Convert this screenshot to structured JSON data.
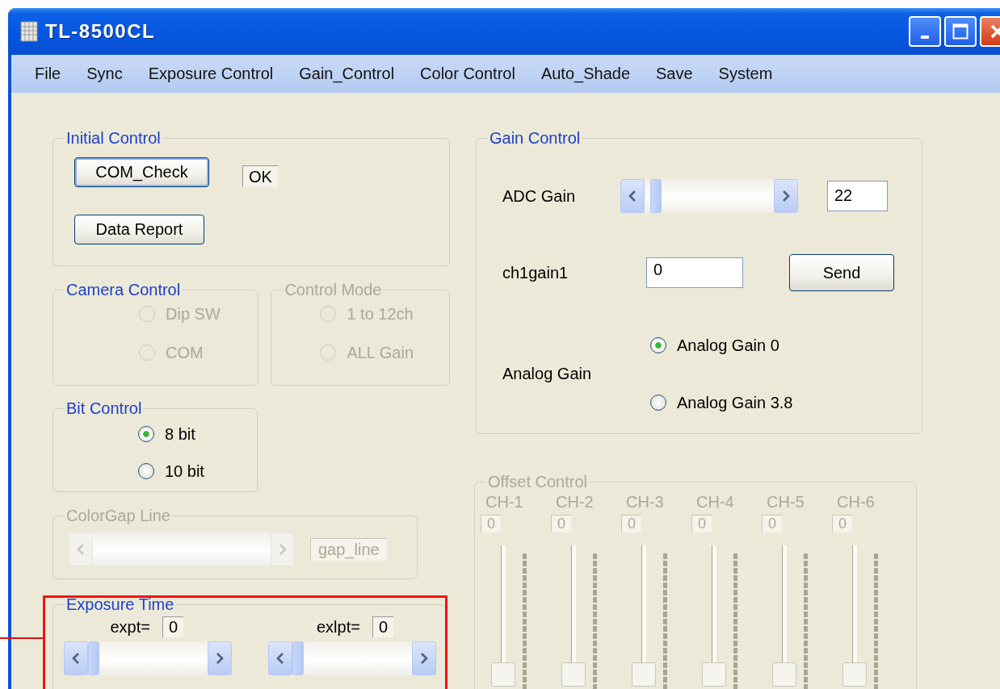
{
  "window": {
    "title": "TL-8500CL"
  },
  "menu": [
    "File",
    "Sync",
    "Exposure Control",
    "Gain_Control",
    "Color Control",
    "Auto_Shade",
    "Save",
    "System"
  ],
  "initial_control": {
    "title": "Initial Control",
    "disabled": false,
    "buttons": [
      {
        "label": "COM_Check",
        "focused": true
      },
      {
        "label": "Data Report",
        "focused": false
      }
    ],
    "status": "OK"
  },
  "camera_control": {
    "title": "Camera Control",
    "disabled": false,
    "options": [
      {
        "label": "Dip SW",
        "selected": false,
        "disabled": true
      },
      {
        "label": "COM",
        "selected": false,
        "disabled": true
      }
    ]
  },
  "control_mode": {
    "title": "Control Mode",
    "disabled": true,
    "options": [
      {
        "label": "1 to 12ch",
        "selected": false,
        "disabled": true
      },
      {
        "label": "ALL Gain",
        "selected": false,
        "disabled": true
      }
    ]
  },
  "bit_control": {
    "title": "Bit Control",
    "disabled": false,
    "options": [
      {
        "label": "8 bit",
        "selected": true,
        "disabled": false
      },
      {
        "label": "10 bit",
        "selected": false,
        "disabled": false
      }
    ]
  },
  "colorgap_line": {
    "title": "ColorGap Line",
    "disabled": true,
    "value": "gap_line"
  },
  "exposure_time": {
    "title": "Exposure Time",
    "disabled": false,
    "highlighted": true,
    "sliders": [
      {
        "label": "expt=",
        "value": "0",
        "level": 0
      },
      {
        "label": "exlpt=",
        "value": "0",
        "level": 0
      }
    ]
  },
  "gain_control": {
    "title": "Gain Control",
    "disabled": false,
    "adc_gain": {
      "label": "ADC Gain",
      "level": 0.05,
      "value": "22"
    },
    "ch1gain1": {
      "label": "ch1gain1",
      "value": "0"
    },
    "send_button": "Send",
    "analog_gain": {
      "label": "Analog Gain",
      "options": [
        {
          "label": "Analog Gain 0",
          "selected": true,
          "disabled": false
        },
        {
          "label": "Analog Gain 3.8",
          "selected": false,
          "disabled": false
        }
      ]
    }
  },
  "offset_control": {
    "title": "Offset Control",
    "disabled": true,
    "channels": [
      {
        "label": "CH-1",
        "value": "0",
        "level": 0
      },
      {
        "label": "CH-2",
        "value": "0",
        "level": 0
      },
      {
        "label": "CH-3",
        "value": "0",
        "level": 0
      },
      {
        "label": "CH-4",
        "value": "0",
        "level": 0
      },
      {
        "label": "CH-5",
        "value": "0",
        "level": 0
      },
      {
        "label": "CH-6",
        "value": "0",
        "level": 0
      }
    ]
  }
}
